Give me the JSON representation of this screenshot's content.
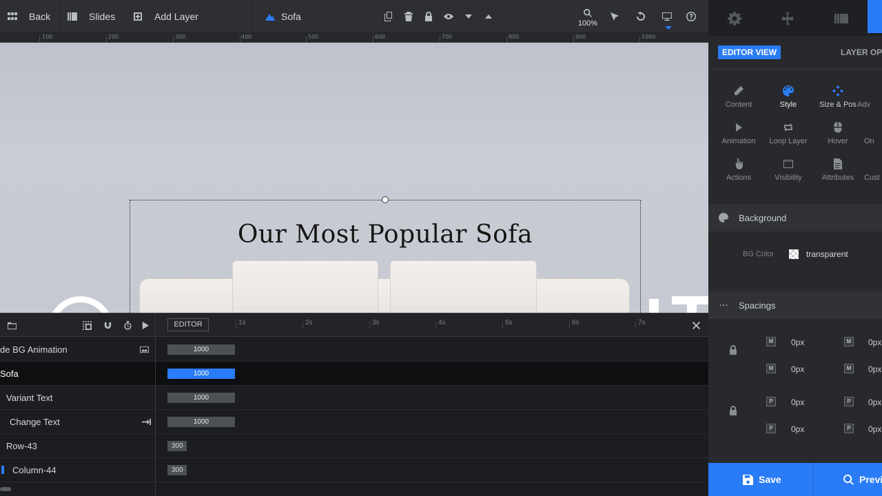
{
  "toolbar": {
    "back_label": "Back",
    "slides_label": "Slides",
    "add_layer_label": "Add Layer",
    "layer_name": "Sofa",
    "zoom": "100%"
  },
  "ruler": {
    "ticks": [
      "100",
      "200",
      "300",
      "400",
      "500",
      "600",
      "700",
      "800",
      "900",
      "1000"
    ]
  },
  "canvas": {
    "headline": "Our Most Popular Sofa"
  },
  "right_panel": {
    "editor_view_label": "EDITOR VIEW",
    "layer_options_label": "LAYER OP",
    "options": [
      {
        "label": "Content",
        "icon": "pencil-icon"
      },
      {
        "label": "Style",
        "icon": "palette-icon",
        "active": true
      },
      {
        "label": "Size & Pos",
        "icon": "move-icon"
      },
      {
        "label": "Adv",
        "icon": "advanced-icon"
      },
      {
        "label": "Animation",
        "icon": "play-icon"
      },
      {
        "label": "Loop Layer",
        "icon": "loop-icon"
      },
      {
        "label": "Hover",
        "icon": "mouse-icon"
      },
      {
        "label": "On",
        "icon": "on-icon"
      },
      {
        "label": "Actions",
        "icon": "hand-icon"
      },
      {
        "label": "Visibility",
        "icon": "visibility-icon"
      },
      {
        "label": "Attributes",
        "icon": "document-icon"
      },
      {
        "label": "Cust",
        "icon": "custom-icon"
      }
    ],
    "background_section": "Background",
    "bg_color_label": "BG Color",
    "bg_color_value": "transparent",
    "spacings_section": "Spacings",
    "margin_values": [
      "0px",
      "0px",
      "0px",
      "0px"
    ],
    "padding_values": [
      "0px",
      "0px",
      "0px",
      "0px"
    ],
    "save_label": "Save",
    "preview_label": "Previ"
  },
  "timeline": {
    "editor_label": "EDITOR",
    "seconds": [
      "1s",
      "2s",
      "3s",
      "4s",
      "5s",
      "6s",
      "7s"
    ],
    "rows": [
      {
        "name": "de BG Animation",
        "value": "1000"
      },
      {
        "name": "Sofa",
        "value": "1000",
        "selected": true
      },
      {
        "name": "Variant Text",
        "value": "1000"
      },
      {
        "name": "Change Text",
        "value": "1000"
      },
      {
        "name": "Row-43",
        "value": "300"
      },
      {
        "name": "Column-44",
        "value": "300"
      }
    ]
  },
  "colors": {
    "accent": "#2a7cf6",
    "toolbar_bg": "#2d2f33",
    "panel_bg": "#28292c"
  }
}
